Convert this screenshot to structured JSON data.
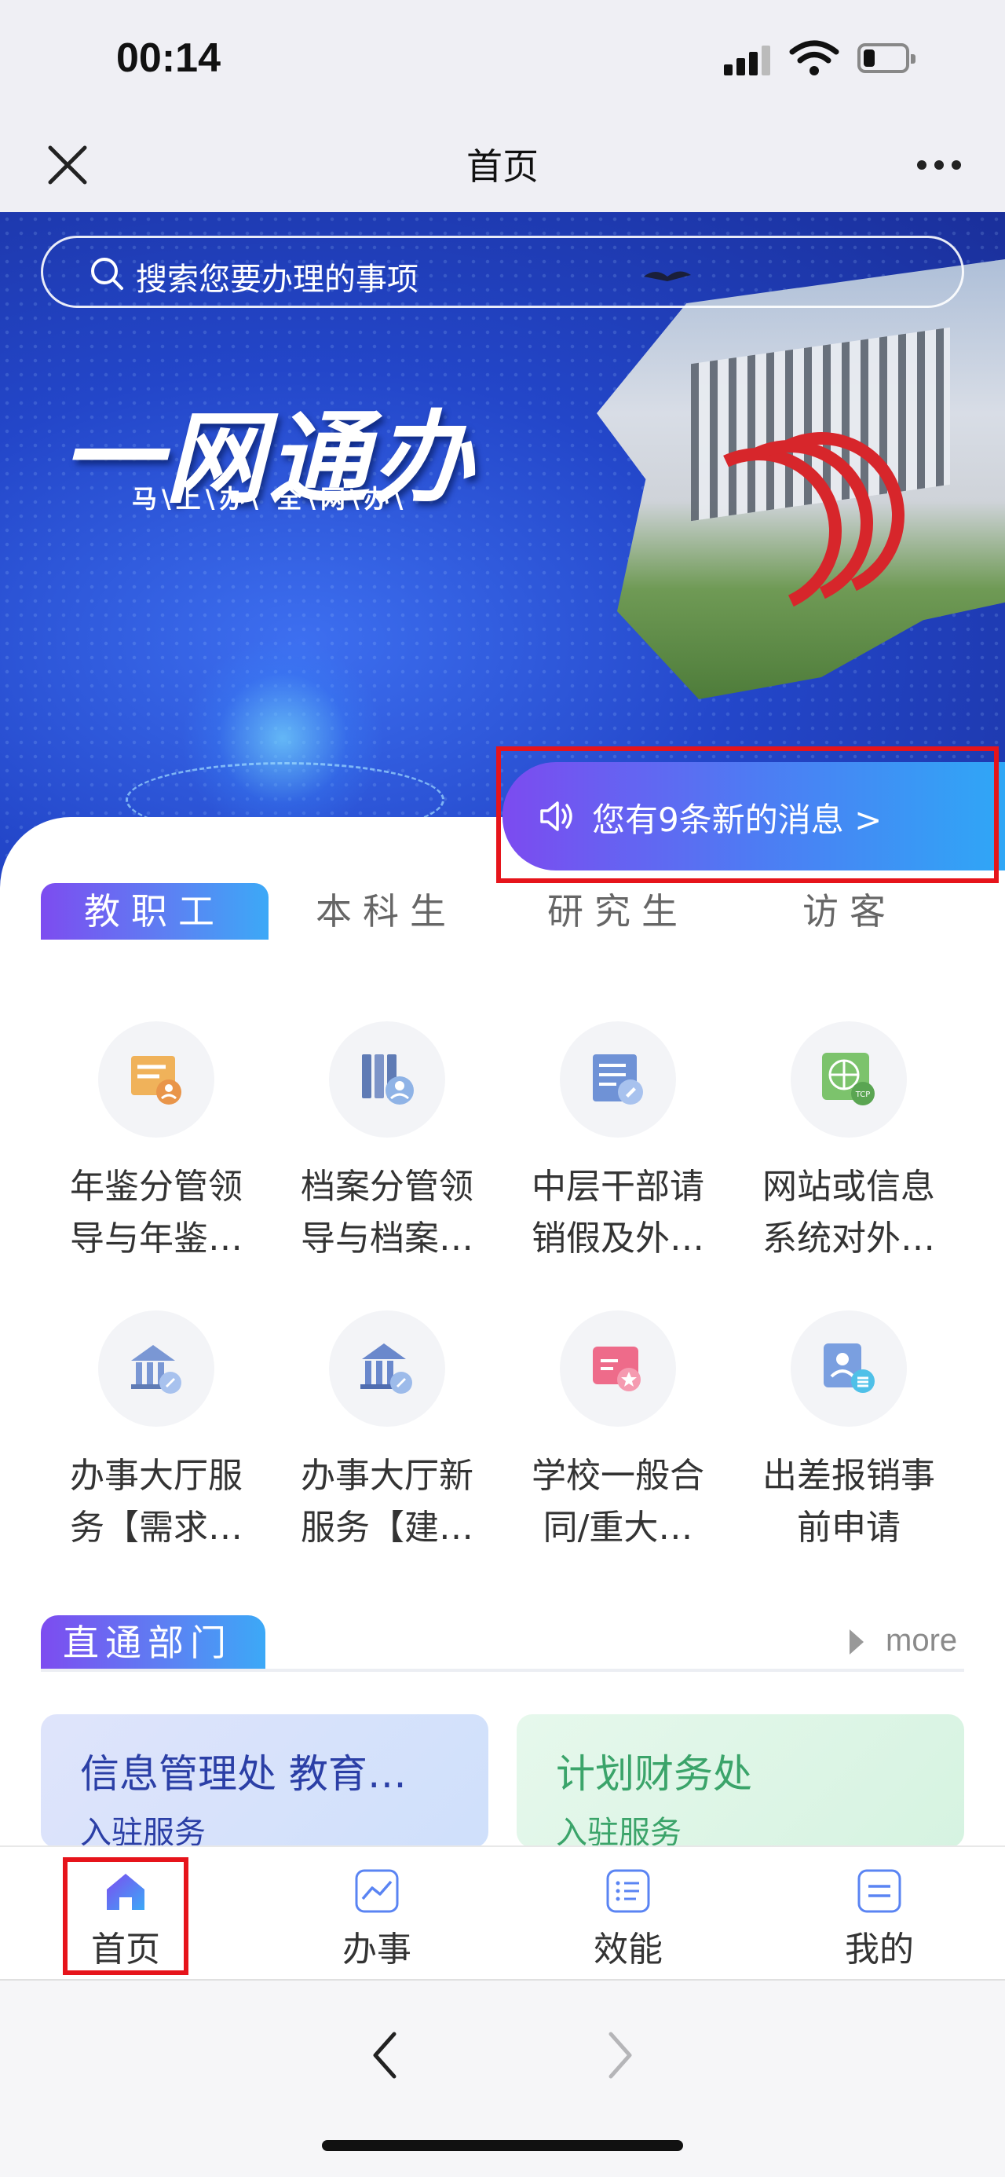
{
  "status_bar": {
    "time": "00:14"
  },
  "nav": {
    "title": "首页"
  },
  "banner": {
    "search_placeholder": "搜索您要办理的事项",
    "title": "一网通办",
    "subtitle": "马\\上\\办\\   全\\网\\办\\"
  },
  "notice": {
    "text": "您有9条新的消息 >"
  },
  "tabs": [
    {
      "label": "教职工",
      "active": true
    },
    {
      "label": "本科生",
      "active": false
    },
    {
      "label": "研究生",
      "active": false
    },
    {
      "label": "访客",
      "active": false
    }
  ],
  "services": [
    {
      "label_line1": "年鉴分管领",
      "label_line2": "导与年鉴…",
      "icon": "yearbook-icon"
    },
    {
      "label_line1": "档案分管领",
      "label_line2": "导与档案…",
      "icon": "archive-icon"
    },
    {
      "label_line1": "中层干部请",
      "label_line2": "销假及外…",
      "icon": "leave-request-icon"
    },
    {
      "label_line1": "网站或信息",
      "label_line2": "系统对外…",
      "icon": "network-tcp-icon"
    },
    {
      "label_line1": "办事大厅服",
      "label_line2": "务【需求…",
      "icon": "service-hall-icon"
    },
    {
      "label_line1": "办事大厅新",
      "label_line2": "服务【建…",
      "icon": "service-hall-new-icon"
    },
    {
      "label_line1": "学校一般合",
      "label_line2": "同/重大…",
      "icon": "contract-icon"
    },
    {
      "label_line1": "出差报销事",
      "label_line2": "前申请",
      "icon": "travel-reimburse-icon"
    }
  ],
  "section": {
    "title": "直通部门",
    "more": "more"
  },
  "departments": [
    {
      "title": "信息管理处 教育…",
      "sub": "入驻服务"
    },
    {
      "title": "计划财务处",
      "sub": "入驻服务"
    }
  ],
  "tabbar": [
    {
      "label": "首页",
      "icon": "home-icon"
    },
    {
      "label": "办事",
      "icon": "chart-icon"
    },
    {
      "label": "效能",
      "icon": "list-icon"
    },
    {
      "label": "我的",
      "icon": "profile-icon"
    }
  ],
  "colors": {
    "accent_gradient_start": "#7d4cf0",
    "accent_gradient_end": "#3ca9f7",
    "highlight_red": "#e6141b"
  }
}
